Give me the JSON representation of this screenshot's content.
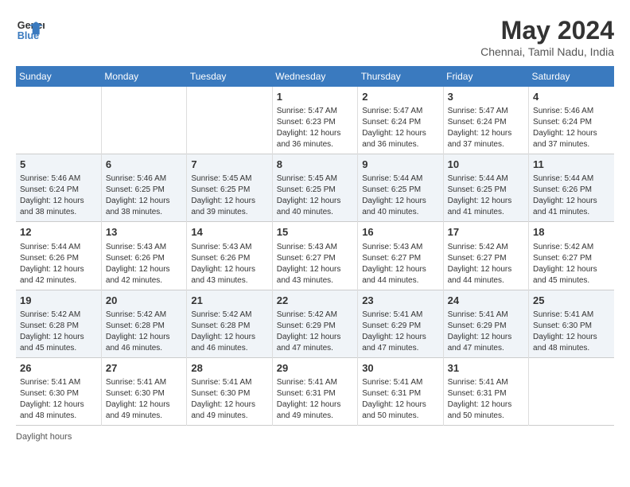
{
  "header": {
    "logo_line1": "General",
    "logo_line2": "Blue",
    "month_year": "May 2024",
    "location": "Chennai, Tamil Nadu, India"
  },
  "days_of_week": [
    "Sunday",
    "Monday",
    "Tuesday",
    "Wednesday",
    "Thursday",
    "Friday",
    "Saturday"
  ],
  "footer": {
    "daylight_label": "Daylight hours"
  },
  "weeks": [
    [
      {
        "num": "",
        "info": ""
      },
      {
        "num": "",
        "info": ""
      },
      {
        "num": "",
        "info": ""
      },
      {
        "num": "1",
        "info": "Sunrise: 5:47 AM\nSunset: 6:23 PM\nDaylight: 12 hours\nand 36 minutes."
      },
      {
        "num": "2",
        "info": "Sunrise: 5:47 AM\nSunset: 6:24 PM\nDaylight: 12 hours\nand 36 minutes."
      },
      {
        "num": "3",
        "info": "Sunrise: 5:47 AM\nSunset: 6:24 PM\nDaylight: 12 hours\nand 37 minutes."
      },
      {
        "num": "4",
        "info": "Sunrise: 5:46 AM\nSunset: 6:24 PM\nDaylight: 12 hours\nand 37 minutes."
      }
    ],
    [
      {
        "num": "5",
        "info": "Sunrise: 5:46 AM\nSunset: 6:24 PM\nDaylight: 12 hours\nand 38 minutes."
      },
      {
        "num": "6",
        "info": "Sunrise: 5:46 AM\nSunset: 6:25 PM\nDaylight: 12 hours\nand 38 minutes."
      },
      {
        "num": "7",
        "info": "Sunrise: 5:45 AM\nSunset: 6:25 PM\nDaylight: 12 hours\nand 39 minutes."
      },
      {
        "num": "8",
        "info": "Sunrise: 5:45 AM\nSunset: 6:25 PM\nDaylight: 12 hours\nand 40 minutes."
      },
      {
        "num": "9",
        "info": "Sunrise: 5:44 AM\nSunset: 6:25 PM\nDaylight: 12 hours\nand 40 minutes."
      },
      {
        "num": "10",
        "info": "Sunrise: 5:44 AM\nSunset: 6:25 PM\nDaylight: 12 hours\nand 41 minutes."
      },
      {
        "num": "11",
        "info": "Sunrise: 5:44 AM\nSunset: 6:26 PM\nDaylight: 12 hours\nand 41 minutes."
      }
    ],
    [
      {
        "num": "12",
        "info": "Sunrise: 5:44 AM\nSunset: 6:26 PM\nDaylight: 12 hours\nand 42 minutes."
      },
      {
        "num": "13",
        "info": "Sunrise: 5:43 AM\nSunset: 6:26 PM\nDaylight: 12 hours\nand 42 minutes."
      },
      {
        "num": "14",
        "info": "Sunrise: 5:43 AM\nSunset: 6:26 PM\nDaylight: 12 hours\nand 43 minutes."
      },
      {
        "num": "15",
        "info": "Sunrise: 5:43 AM\nSunset: 6:27 PM\nDaylight: 12 hours\nand 43 minutes."
      },
      {
        "num": "16",
        "info": "Sunrise: 5:43 AM\nSunset: 6:27 PM\nDaylight: 12 hours\nand 44 minutes."
      },
      {
        "num": "17",
        "info": "Sunrise: 5:42 AM\nSunset: 6:27 PM\nDaylight: 12 hours\nand 44 minutes."
      },
      {
        "num": "18",
        "info": "Sunrise: 5:42 AM\nSunset: 6:27 PM\nDaylight: 12 hours\nand 45 minutes."
      }
    ],
    [
      {
        "num": "19",
        "info": "Sunrise: 5:42 AM\nSunset: 6:28 PM\nDaylight: 12 hours\nand 45 minutes."
      },
      {
        "num": "20",
        "info": "Sunrise: 5:42 AM\nSunset: 6:28 PM\nDaylight: 12 hours\nand 46 minutes."
      },
      {
        "num": "21",
        "info": "Sunrise: 5:42 AM\nSunset: 6:28 PM\nDaylight: 12 hours\nand 46 minutes."
      },
      {
        "num": "22",
        "info": "Sunrise: 5:42 AM\nSunset: 6:29 PM\nDaylight: 12 hours\nand 47 minutes."
      },
      {
        "num": "23",
        "info": "Sunrise: 5:41 AM\nSunset: 6:29 PM\nDaylight: 12 hours\nand 47 minutes."
      },
      {
        "num": "24",
        "info": "Sunrise: 5:41 AM\nSunset: 6:29 PM\nDaylight: 12 hours\nand 47 minutes."
      },
      {
        "num": "25",
        "info": "Sunrise: 5:41 AM\nSunset: 6:30 PM\nDaylight: 12 hours\nand 48 minutes."
      }
    ],
    [
      {
        "num": "26",
        "info": "Sunrise: 5:41 AM\nSunset: 6:30 PM\nDaylight: 12 hours\nand 48 minutes."
      },
      {
        "num": "27",
        "info": "Sunrise: 5:41 AM\nSunset: 6:30 PM\nDaylight: 12 hours\nand 49 minutes."
      },
      {
        "num": "28",
        "info": "Sunrise: 5:41 AM\nSunset: 6:30 PM\nDaylight: 12 hours\nand 49 minutes."
      },
      {
        "num": "29",
        "info": "Sunrise: 5:41 AM\nSunset: 6:31 PM\nDaylight: 12 hours\nand 49 minutes."
      },
      {
        "num": "30",
        "info": "Sunrise: 5:41 AM\nSunset: 6:31 PM\nDaylight: 12 hours\nand 50 minutes."
      },
      {
        "num": "31",
        "info": "Sunrise: 5:41 AM\nSunset: 6:31 PM\nDaylight: 12 hours\nand 50 minutes."
      },
      {
        "num": "",
        "info": ""
      }
    ]
  ]
}
